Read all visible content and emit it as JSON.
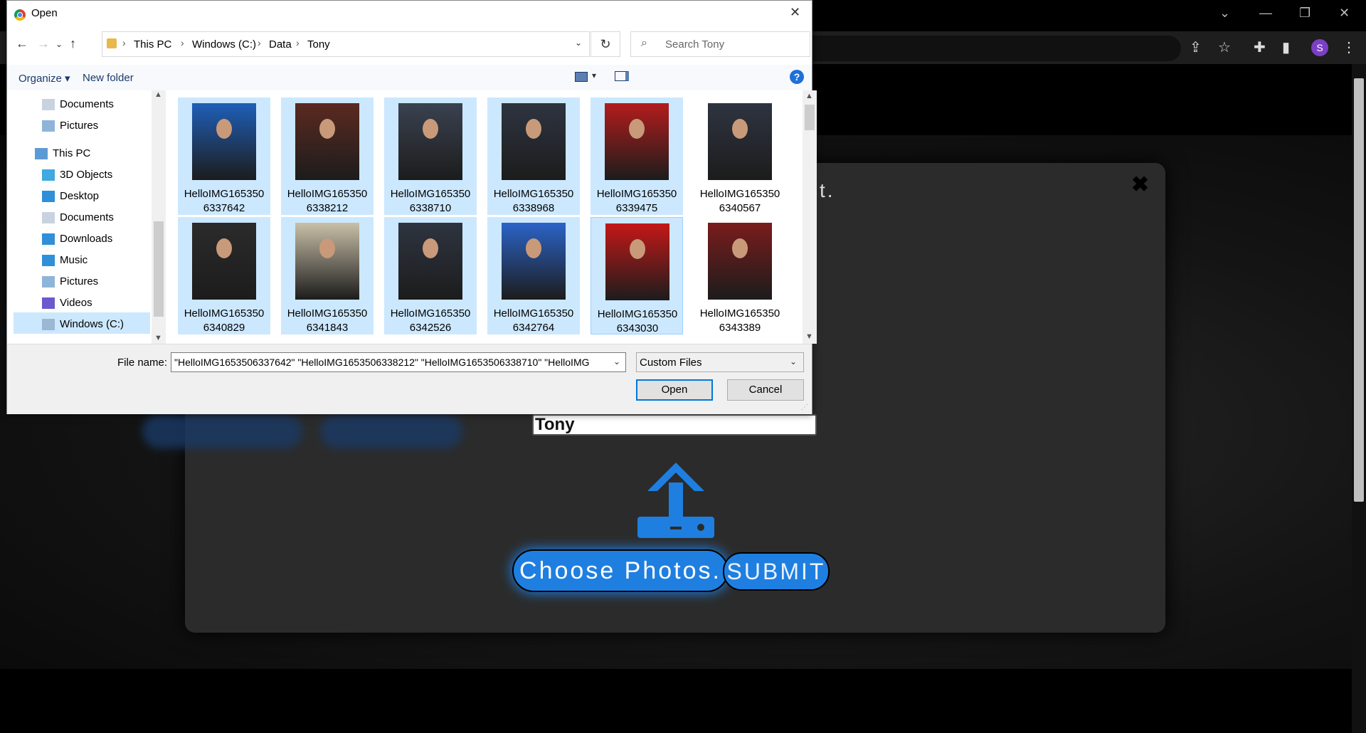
{
  "browser": {
    "profile_initial": "S",
    "window_controls": [
      "⌄",
      "—",
      "❐",
      "✕"
    ],
    "accent": "#7b3fc4"
  },
  "page": {
    "modal_text": "ct.",
    "name_input_value": "Tony",
    "choose_label": "Choose Photos.",
    "submit_label": "SUBMIT",
    "accent": "#1e7fe0"
  },
  "dialog": {
    "title": "Open",
    "breadcrumb": [
      "This PC",
      "Windows (C:)",
      "Data",
      "Tony"
    ],
    "search_placeholder": "Search Tony",
    "toolbar": {
      "organize": "Organize",
      "new_folder": "New folder"
    },
    "sidebar": [
      {
        "label": "Documents",
        "icon": "documents-icon",
        "indent": 1
      },
      {
        "label": "Pictures",
        "icon": "pictures-icon",
        "indent": 1
      },
      {
        "label": "This PC",
        "icon": "computer-icon",
        "indent": 0
      },
      {
        "label": "3D Objects",
        "icon": "3d-objects-icon",
        "indent": 1
      },
      {
        "label": "Desktop",
        "icon": "desktop-icon",
        "indent": 1
      },
      {
        "label": "Documents",
        "icon": "documents-icon",
        "indent": 1
      },
      {
        "label": "Downloads",
        "icon": "downloads-icon",
        "indent": 1
      },
      {
        "label": "Music",
        "icon": "music-icon",
        "indent": 1
      },
      {
        "label": "Pictures",
        "icon": "pictures-icon",
        "indent": 1
      },
      {
        "label": "Videos",
        "icon": "videos-icon",
        "indent": 1
      },
      {
        "label": "Windows (C:)",
        "icon": "drive-icon",
        "indent": 1,
        "selected": true
      }
    ],
    "files": [
      {
        "name": "HelloIMG1653506337642",
        "line1": "HelloIMG165350",
        "line2": "6337642",
        "selected": true
      },
      {
        "name": "HelloIMG1653506338212",
        "line1": "HelloIMG165350",
        "line2": "6338212",
        "selected": true
      },
      {
        "name": "HelloIMG1653506338710",
        "line1": "HelloIMG165350",
        "line2": "6338710",
        "selected": true
      },
      {
        "name": "HelloIMG1653506338968",
        "line1": "HelloIMG165350",
        "line2": "6338968",
        "selected": true
      },
      {
        "name": "HelloIMG1653506339475",
        "line1": "HelloIMG165350",
        "line2": "6339475",
        "selected": true
      },
      {
        "name": "HelloIMG1653506340567",
        "line1": "HelloIMG165350",
        "line2": "6340567",
        "selected": false
      },
      {
        "name": "HelloIMG1653506340829",
        "line1": "HelloIMG165350",
        "line2": "6340829",
        "selected": true
      },
      {
        "name": "HelloIMG1653506341843",
        "line1": "HelloIMG165350",
        "line2": "6341843",
        "selected": true
      },
      {
        "name": "HelloIMG1653506342526",
        "line1": "HelloIMG165350",
        "line2": "6342526",
        "selected": true
      },
      {
        "name": "HelloIMG1653506342764",
        "line1": "HelloIMG165350",
        "line2": "6342764",
        "selected": true
      },
      {
        "name": "HelloIMG1653506343030",
        "line1": "HelloIMG165350",
        "line2": "6343030",
        "selected": true,
        "focused": true
      },
      {
        "name": "HelloIMG1653506343389",
        "line1": "HelloIMG165350",
        "line2": "6343389",
        "selected": false
      }
    ],
    "file_name_label": "File name:",
    "file_name_value": "\"HelloIMG1653506337642\" \"HelloIMG1653506338212\" \"HelloIMG1653506338710\" \"HelloIMG",
    "file_type": "Custom Files",
    "open_label": "Open",
    "cancel_label": "Cancel",
    "selection_color": "#cce8ff"
  }
}
